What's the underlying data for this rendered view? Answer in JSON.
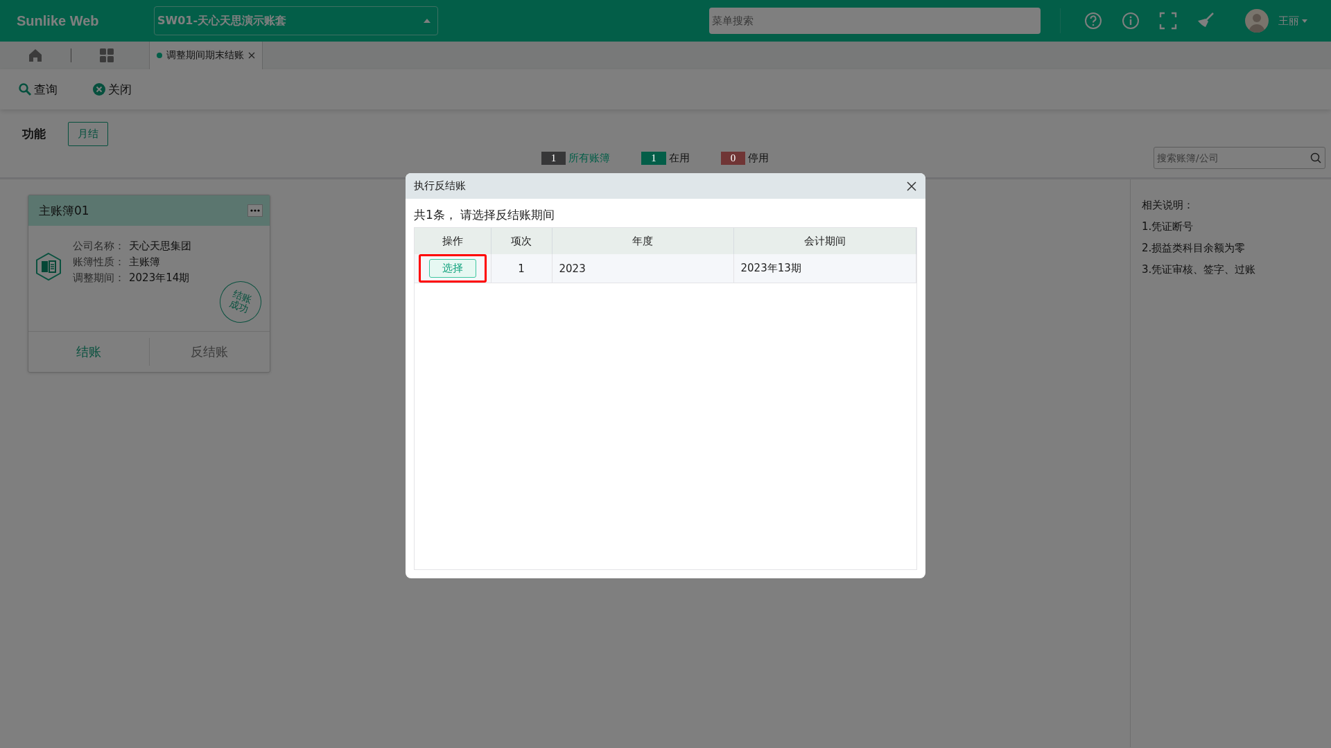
{
  "header": {
    "logo": "Sunlike Web",
    "account_select": "SW01-天心天思演示账套",
    "menu_search": {
      "placeholder": "菜单搜索"
    },
    "user_name": "王丽"
  },
  "tabs": [
    {
      "label": "调整期间期末结账"
    }
  ],
  "toolbar": [
    "查询",
    "关闭"
  ],
  "function_bar": {
    "label": "功能",
    "buttons": [
      "月结"
    ]
  },
  "filters": [
    {
      "count": "1",
      "label": "所有账簿",
      "color": "#373738",
      "selected": true
    },
    {
      "count": "1",
      "label": "在用",
      "color": "#035e48",
      "selected": false
    },
    {
      "count": "0",
      "label": "停用",
      "color": "#703535",
      "selected": false
    }
  ],
  "book_search": {
    "placeholder": "搜索账簿/公司"
  },
  "cards": [
    {
      "title": "主账簿01",
      "fields": [
        {
          "label": "公司名称：",
          "value": "天心天思集团"
        },
        {
          "label": "账簿性质：",
          "value": "主账簿"
        },
        {
          "label": "调整期间：",
          "value": "2023年14期"
        }
      ],
      "stamp": [
        "结账",
        "成功"
      ],
      "actions": [
        {
          "label": "结账",
          "kind": "primary"
        },
        {
          "label": "反结账",
          "kind": "plain"
        }
      ]
    }
  ],
  "notes": {
    "title": "相关说明：",
    "items": [
      "1.凭证断号",
      "2.损益类科目余额为零",
      "3.凭证审核、签字、过账"
    ]
  },
  "dialog": {
    "title": "执行反结账",
    "summary": "共1条， 请选择反结账期间",
    "columns": [
      "操作",
      "项次",
      "年度",
      "会计期间"
    ],
    "rows": [
      {
        "highlighted": true,
        "cells": [
          "选择",
          "1",
          "2023",
          "2023年13期"
        ]
      }
    ]
  }
}
